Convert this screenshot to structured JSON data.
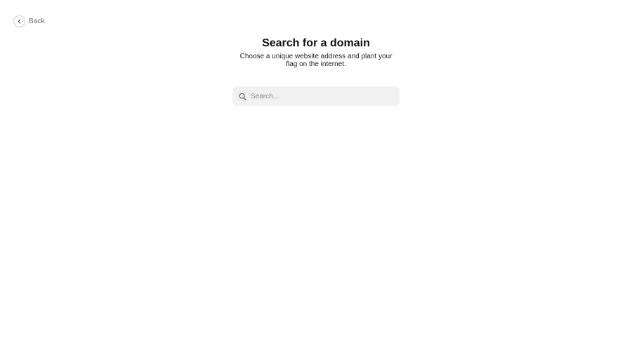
{
  "nav": {
    "back_label": "Back",
    "back_icon": "chevron-left-icon"
  },
  "page": {
    "title": "Search for a domain",
    "subtitle": "Choose a unique website address and plant your flag on the internet."
  },
  "search": {
    "icon": "search-icon",
    "value": "",
    "placeholder": "Search..."
  },
  "colors": {
    "background": "#ffffff",
    "search_background": "#f1f1f1",
    "text_primary": "#111111",
    "text_muted": "#666666"
  }
}
